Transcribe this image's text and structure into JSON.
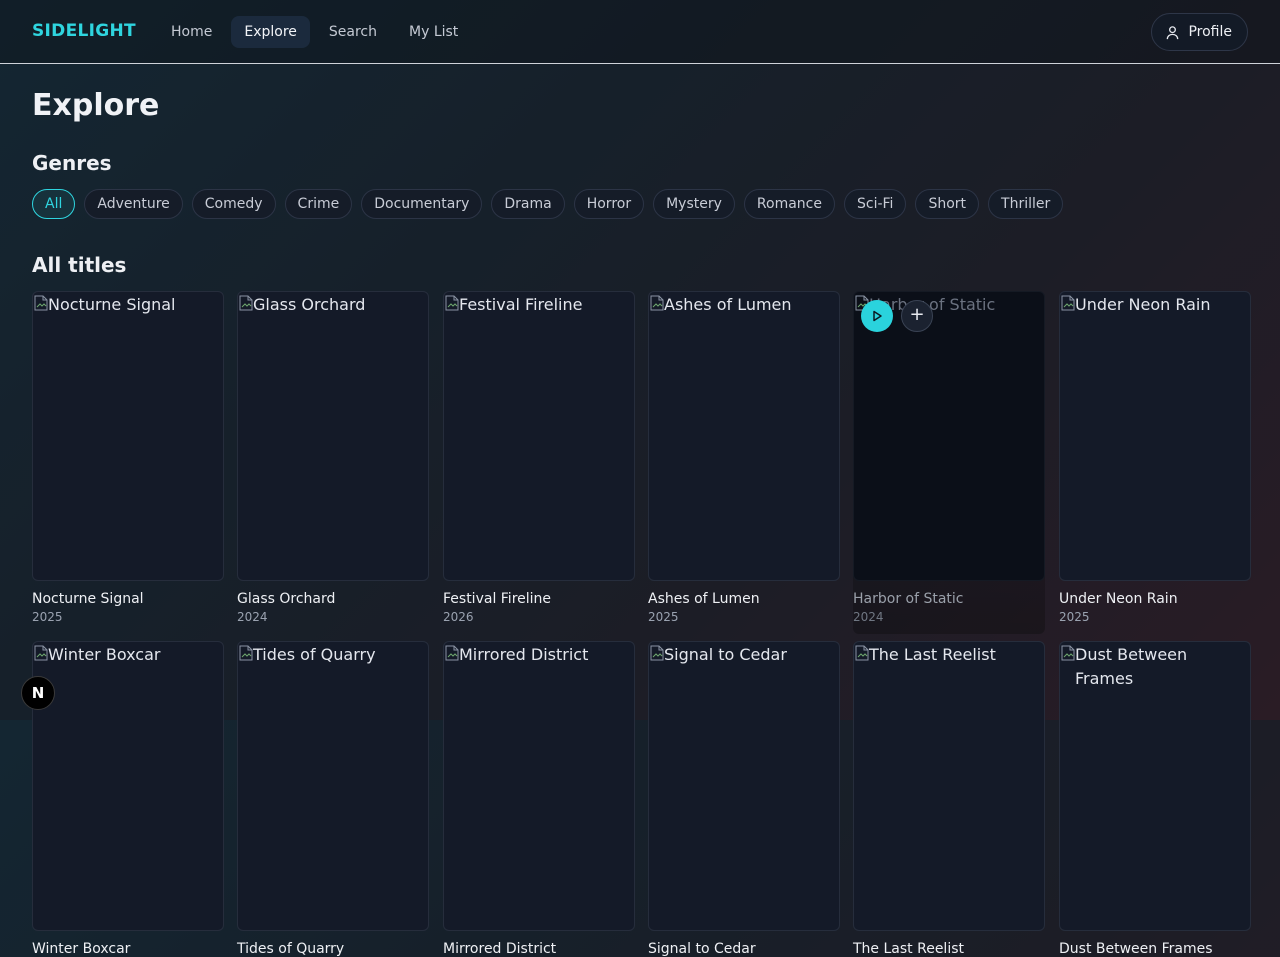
{
  "app": {
    "brand": "SIDELIGHT"
  },
  "nav": {
    "items": [
      {
        "label": "Home",
        "active": false
      },
      {
        "label": "Explore",
        "active": true
      },
      {
        "label": "Search",
        "active": false
      },
      {
        "label": "My List",
        "active": false
      }
    ],
    "profile_label": "Profile"
  },
  "page": {
    "title": "Explore"
  },
  "genres": {
    "heading": "Genres",
    "items": [
      "All",
      "Adventure",
      "Comedy",
      "Crime",
      "Documentary",
      "Drama",
      "Horror",
      "Mystery",
      "Romance",
      "Sci-Fi",
      "Short",
      "Thriller"
    ],
    "selected": "All"
  },
  "titles": {
    "heading": "All titles",
    "items": [
      {
        "title": "Nocturne Signal",
        "year": "2025"
      },
      {
        "title": "Glass Orchard",
        "year": "2024"
      },
      {
        "title": "Festival Fireline",
        "year": "2026"
      },
      {
        "title": "Ashes of Lumen",
        "year": "2025"
      },
      {
        "title": "Harbor of Static",
        "year": "2024",
        "hovered": true
      },
      {
        "title": "Under Neon Rain",
        "year": "2025"
      },
      {
        "title": "Winter Boxcar",
        "year": ""
      },
      {
        "title": "Tides of Quarry",
        "year": ""
      },
      {
        "title": "Mirrored District",
        "year": ""
      },
      {
        "title": "Signal to Cedar",
        "year": ""
      },
      {
        "title": "The Last Reelist",
        "year": ""
      },
      {
        "title": "Dust Between Frames",
        "year": ""
      }
    ]
  },
  "colors": {
    "accent": "#2fd5df",
    "background": "#16202a"
  },
  "dev_badge": {
    "label": "N"
  }
}
